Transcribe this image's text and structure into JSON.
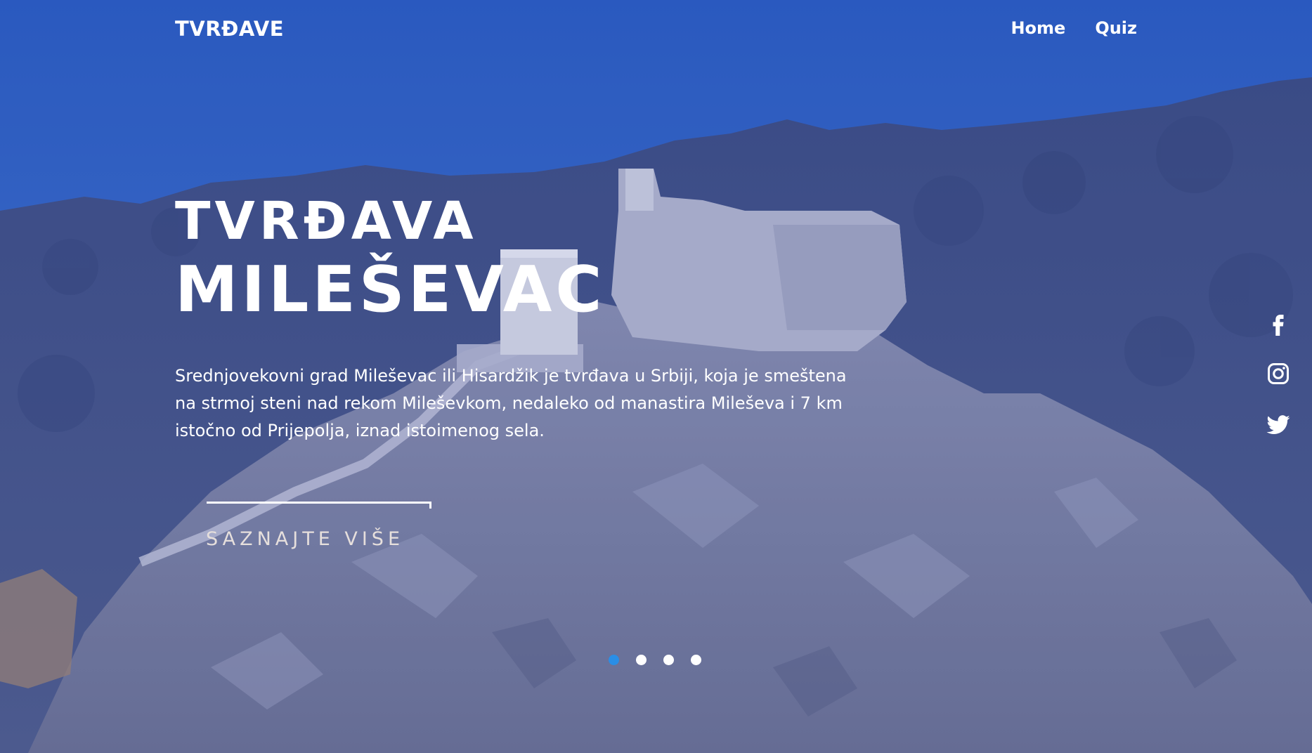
{
  "header": {
    "logo": "TVRĐAVE",
    "nav": [
      {
        "label": "Home"
      },
      {
        "label": "Quiz"
      }
    ]
  },
  "hero": {
    "title_line1": "TVRĐAVA",
    "title_line2": "MILEŠEVAC",
    "description": "Srednjovekovni grad Mileševac ili Hisardžik je tvrđava u Srbiji, koja je smeštena na strmoj steni nad rekom Mileševkom, nedaleko od manastira Mileševa i 7 km istočno od Prijepolja, iznad istoimenog sela.",
    "cta_label": "SAZNAJTE VIŠE"
  },
  "social": [
    {
      "icon": "facebook-icon"
    },
    {
      "icon": "instagram-icon"
    },
    {
      "icon": "twitter-icon"
    }
  ],
  "slider": {
    "total": 4,
    "active_index": 0
  },
  "colors": {
    "accent": "#2a8ee6",
    "text": "#ffffff",
    "cta_text": "#e6dfdc",
    "sky": "#3c6fd0"
  }
}
